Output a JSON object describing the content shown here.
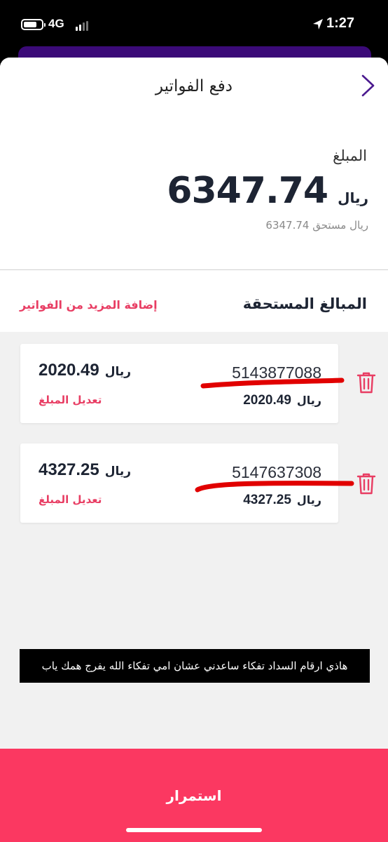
{
  "status_bar": {
    "network": "4G",
    "time": "1:27"
  },
  "header": {
    "title": "دفع الفواتير"
  },
  "summary": {
    "amount_label": "المبلغ",
    "amount": "6347.74",
    "currency": "ريال",
    "due_text": "6347.74 ريال مستحق"
  },
  "due_section": {
    "title": "المبالغ المستحقة",
    "add_more_label": "إضافة المزيد من الفواتير"
  },
  "bills": [
    {
      "number": "5143877088",
      "amount": "2020.49",
      "currency": "ريال",
      "sub_amount": "2020.49",
      "sub_currency": "ريال",
      "edit_label": "تعديل المبلغ"
    },
    {
      "number": "5147637308",
      "amount": "4327.25",
      "currency": "ريال",
      "sub_amount": "4327.25",
      "sub_currency": "ريال",
      "edit_label": "تعديل المبلغ"
    }
  ],
  "note": "هاذي ارقام السداد تفكاء ساعدني عشان امي تفكاء الله يفرج همك ياب",
  "continue_label": "استمرار",
  "colors": {
    "accent": "#e83d63",
    "button": "#fb3861",
    "brand_purple": "#3b0a78",
    "redaction": "#e10000"
  }
}
